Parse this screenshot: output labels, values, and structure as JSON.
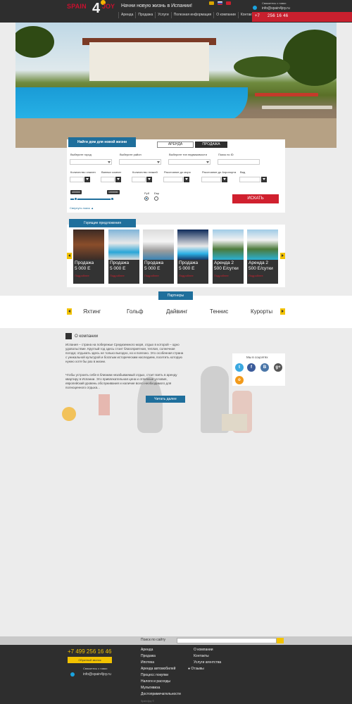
{
  "header": {
    "logo_text_left": "SPAIN",
    "logo_number": "4",
    "logo_text_right": "JOY",
    "tagline": "Начни новую жизнь в Испании!",
    "nav": [
      "Аренда",
      "Продажа",
      "Услуги",
      "Полезная информация",
      "О компании",
      "Контакты"
    ],
    "contact_label": "Свяжитесь с нами:",
    "email": "info@spain4joy.ru",
    "phone_code": "+7",
    "phone_number": "256 16 46",
    "flag_colors": [
      "#d9a400",
      "#f0f0f0",
      "#c8202e"
    ]
  },
  "search": {
    "title": "Найти дом для новой жизни",
    "tab_rent": "АРЕНДА",
    "tab_sale": "ПРОДАЖА",
    "labels": {
      "city": "Выберите город",
      "district": "Выберите район",
      "property_type": "Выберите тип недвижимости",
      "search_id": "Поиск по ID",
      "bedrooms": "Количество спален",
      "bathrooms": "Ванных комнат",
      "floors": "Количество этажей",
      "distance_sea": "Расстояние до моря",
      "distance_airport": "Расстояние до Аэропорта",
      "view": "Вид"
    },
    "price_min": "400000",
    "price_max": "1000000",
    "currency_rub": "Руб",
    "currency_eur": "Евр",
    "button": "ИСКАТЬ",
    "collapse": "Свернуть поиск"
  },
  "offers": {
    "title": "Горящие предложения",
    "cards": [
      {
        "type": "Продажа",
        "price": "5 000  Е",
        "cta": "Подробнее"
      },
      {
        "type": "Продажа",
        "price": "5 000  Е",
        "cta": "Подробнее"
      },
      {
        "type": "Продажа",
        "price": "5 000  Е",
        "cta": "Подробнее"
      },
      {
        "type": "Продажа",
        "price": "5 000  Е",
        "cta": "Подробнее"
      },
      {
        "type": "Аренда 2",
        "price": "500  Е/сутки",
        "cta": "Подробнее"
      },
      {
        "type": "Аренда 2",
        "price": "500  Е/сутки",
        "cta": "Подробнее"
      }
    ]
  },
  "partners": {
    "title": "Партнеры",
    "items": [
      "Яхтинг",
      "Гольф",
      "Дайвинг",
      "Теннис",
      "Курорты"
    ]
  },
  "about": {
    "title": "О компании",
    "paragraph1": "Испания – страна на побережье Средиземного моря, отдых в которой – одно удовольствие. Круглый год здесь стоит благоприятная, теплая, солнечная погода; отдыхать здесь не только выгодно, но и полезно. Это особенная страна с уникальной культурой и богатым историческим наследием, посетить которую нужно хотя бы раз в жизни.",
    "paragraph2": "Чтобы устроить себе в близким незабываемый отдых, стоит взять в аренду квартиру в Испании. Это привлекательная цена и отличные условия, европейский уровень обслуживания и наличие всего необходимого для полноценного отдыха...",
    "more_button": "Читать далее",
    "socials_title": "Мы в соцсетях",
    "socials": [
      "t",
      "f",
      "В",
      "g+",
      "о"
    ]
  },
  "footer": {
    "search_label": "Поиск по сайту",
    "phone": "+7 499 256 16 46",
    "callback": "Обратный звонок",
    "contact_label": "Свяжитесь с нами:",
    "email": "info@spain4joy.ru",
    "col1": [
      "Аренда",
      "Продажа",
      "Ипотека",
      "Аренда автомобилей",
      "Процесс покупки",
      "Налоги и расходы",
      "Мультивиза",
      "Достопримечательности"
    ],
    "col2": [
      "О компании",
      "Контакты",
      "Услуги агентства",
      "Отзывы"
    ],
    "copyright": "Spain4joy ©"
  },
  "colors": {
    "accent_blue": "#1f6f9c",
    "accent_red": "#d0202e",
    "accent_yellow": "#f2c200",
    "dark": "#2e2e2e"
  }
}
